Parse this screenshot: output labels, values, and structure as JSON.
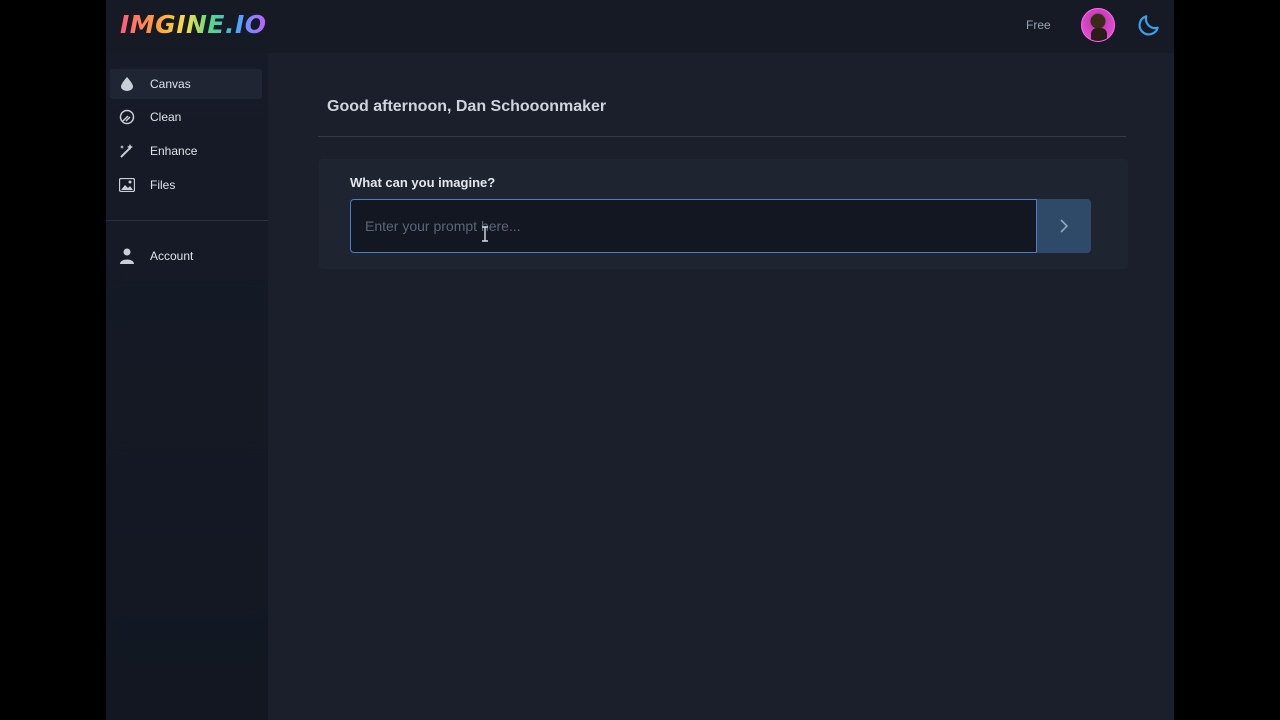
{
  "brand": {
    "logo_text": "IMGINE.IO"
  },
  "header": {
    "plan_label": "Free",
    "avatar_icon": "user-avatar",
    "theme_toggle_icon": "moon-icon"
  },
  "sidebar": {
    "items": [
      {
        "label": "Canvas",
        "icon": "droplet-icon",
        "active": true
      },
      {
        "label": "Clean",
        "icon": "eraser-icon",
        "active": false
      },
      {
        "label": "Enhance",
        "icon": "magic-wand-icon",
        "active": false
      },
      {
        "label": "Files",
        "icon": "image-icon",
        "active": false
      }
    ],
    "account": {
      "label": "Account",
      "icon": "user-icon"
    }
  },
  "main": {
    "greeting": "Good afternoon, Dan Schooonmaker",
    "prompt": {
      "label": "What can you imagine?",
      "placeholder": "Enter your prompt here...",
      "value": "",
      "submit_icon": "chevron-right-icon"
    }
  },
  "colors": {
    "accent": "#4a7fc7",
    "submit_bg": "#2f4a68",
    "moon": "#3aa0e8"
  }
}
